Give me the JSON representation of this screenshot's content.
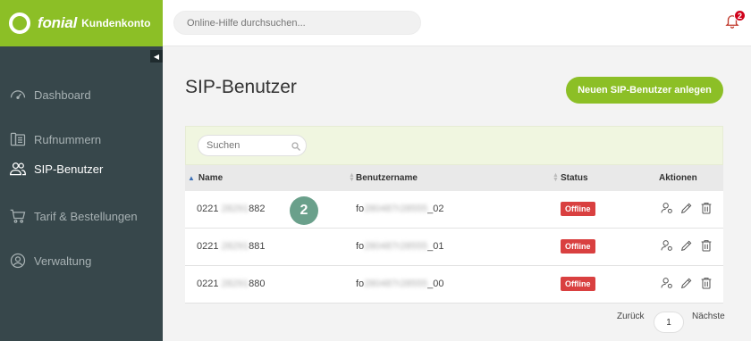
{
  "brand": {
    "name": "fonial",
    "subtitle": "Kundenkonto"
  },
  "header": {
    "search_placeholder": "Online-Hilfe durchsuchen...",
    "notification_count": "2"
  },
  "sidebar": {
    "collapse_glyph": "◀",
    "items": [
      {
        "label": "Dashboard",
        "icon": "speedometer-icon",
        "active": false
      },
      {
        "label": "Rufnummern",
        "icon": "phone-icon",
        "active": false
      },
      {
        "label": "SIP-Benutzer",
        "icon": "users-icon",
        "active": true
      },
      {
        "label": "Tarif & Bestellungen",
        "icon": "cart-icon",
        "active": false
      },
      {
        "label": "Verwaltung",
        "icon": "account-icon",
        "active": false
      }
    ]
  },
  "main": {
    "title": "SIP-Benutzer",
    "new_button": "Neuen SIP-Benutzer anlegen",
    "search_placeholder": "Suchen",
    "columns": {
      "name": "Name",
      "username": "Benutzername",
      "status": "Status",
      "actions": "Aktionen"
    },
    "rows": [
      {
        "name_prefix": "0221 ",
        "name_hidden": "28291",
        "name_suffix": "882",
        "user_prefix": "fo",
        "user_hidden": "280487r28555",
        "user_suffix": "_02",
        "status": "Offline"
      },
      {
        "name_prefix": "0221 ",
        "name_hidden": "28291",
        "name_suffix": "881",
        "user_prefix": "fo",
        "user_hidden": "280487r28555",
        "user_suffix": "_01",
        "status": "Offline"
      },
      {
        "name_prefix": "0221 ",
        "name_hidden": "28291",
        "name_suffix": "880",
        "user_prefix": "fo",
        "user_hidden": "280487r28555",
        "user_suffix": "_00",
        "status": "Offline"
      }
    ],
    "step_marker": "2",
    "pagination": {
      "prev": "Zurück",
      "page": "1",
      "next": "Nächste"
    }
  },
  "colors": {
    "brand_green": "#8cbf26",
    "sidebar_bg": "#37474b",
    "status_red": "#d94040",
    "step_teal": "#6aa08b"
  }
}
